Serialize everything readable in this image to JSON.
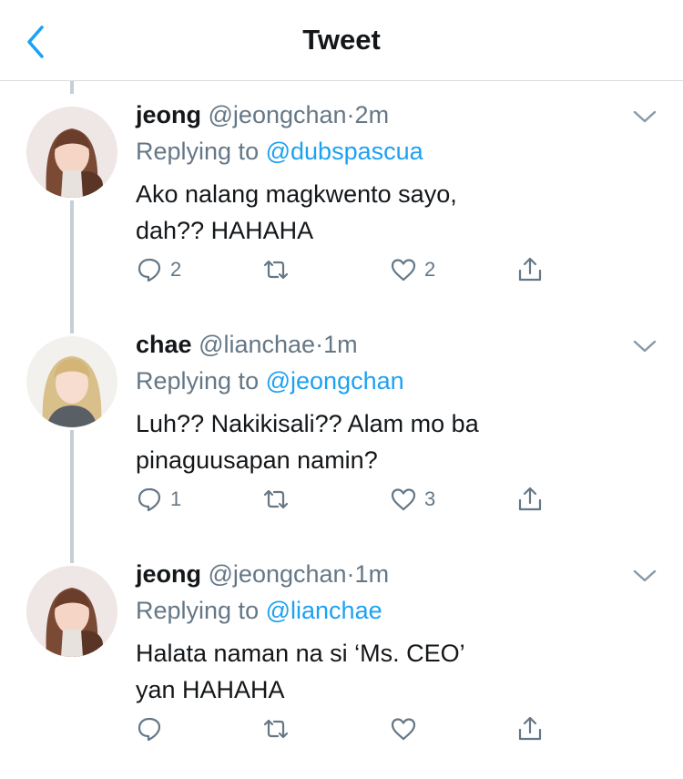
{
  "header": {
    "title": "Tweet",
    "back_icon": "chevron-left-icon"
  },
  "colors": {
    "accent": "#1da1f2",
    "muted": "#657786",
    "thread_line": "#c4cfd6"
  },
  "tweets": [
    {
      "name": "jeong",
      "handle": "@jeongchan",
      "separator": "·",
      "time": "2m",
      "replying_prefix": "Replying to",
      "replying_to": "@dubspascua",
      "text_lines": [
        "Ako nalang magkwento sayo,",
        "dah?? HAHAHA"
      ],
      "counts": {
        "replies": "2",
        "retweets": "",
        "likes": "2"
      }
    },
    {
      "name": "chae",
      "handle": "@lianchae",
      "separator": "·",
      "time": "1m",
      "replying_prefix": "Replying to",
      "replying_to": "@jeongchan",
      "text_lines": [
        "Luh?? Nakikisali?? Alam mo ba",
        "pinaguusapan namin?"
      ],
      "counts": {
        "replies": "1",
        "retweets": "",
        "likes": "3"
      }
    },
    {
      "name": "jeong",
      "handle": "@jeongchan",
      "separator": "·",
      "time": "1m",
      "replying_prefix": "Replying to",
      "replying_to": "@lianchae",
      "text_lines": [
        "Halata naman na si ‘Ms. CEO’",
        "yan HAHAHA"
      ],
      "counts": {
        "replies": "",
        "retweets": "",
        "likes": ""
      }
    }
  ]
}
